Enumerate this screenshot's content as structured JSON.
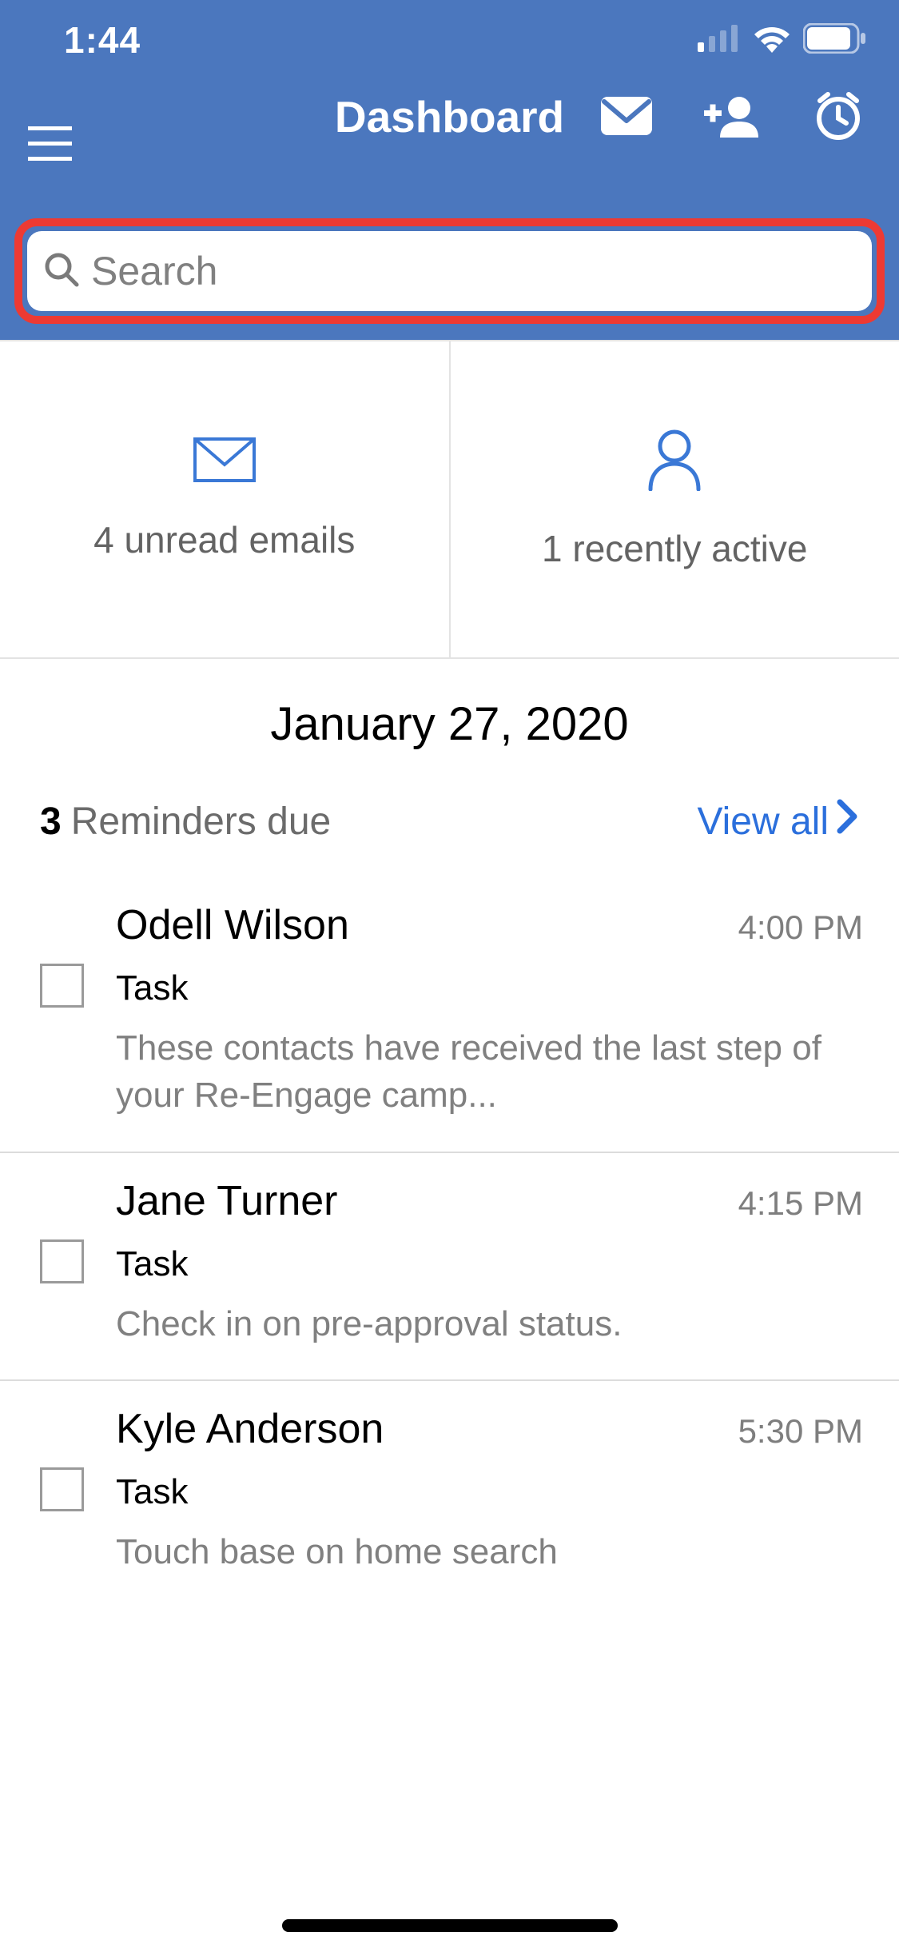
{
  "status": {
    "time": "1:44"
  },
  "nav": {
    "title": "Dashboard"
  },
  "search": {
    "placeholder": "Search",
    "value": ""
  },
  "cards": {
    "emails": {
      "label": "4 unread emails"
    },
    "active": {
      "label": "1 recently active"
    }
  },
  "date": "January 27, 2020",
  "reminders": {
    "count": "3",
    "label": "Reminders due",
    "view_all": "View all",
    "items": [
      {
        "name": "Odell Wilson",
        "time": "4:00 PM",
        "type": "Task",
        "note": "These contacts have received the last step of your Re-Engage camp..."
      },
      {
        "name": "Jane Turner",
        "time": "4:15 PM",
        "type": "Task",
        "note": "Check in on pre-approval status."
      },
      {
        "name": "Kyle Anderson",
        "time": "5:30 PM",
        "type": "Task",
        "note": "Touch base on home search"
      }
    ]
  },
  "colors": {
    "primary_blue": "#4b77be",
    "highlight_red": "#ed3a33",
    "link_blue": "#2b6fdc"
  }
}
